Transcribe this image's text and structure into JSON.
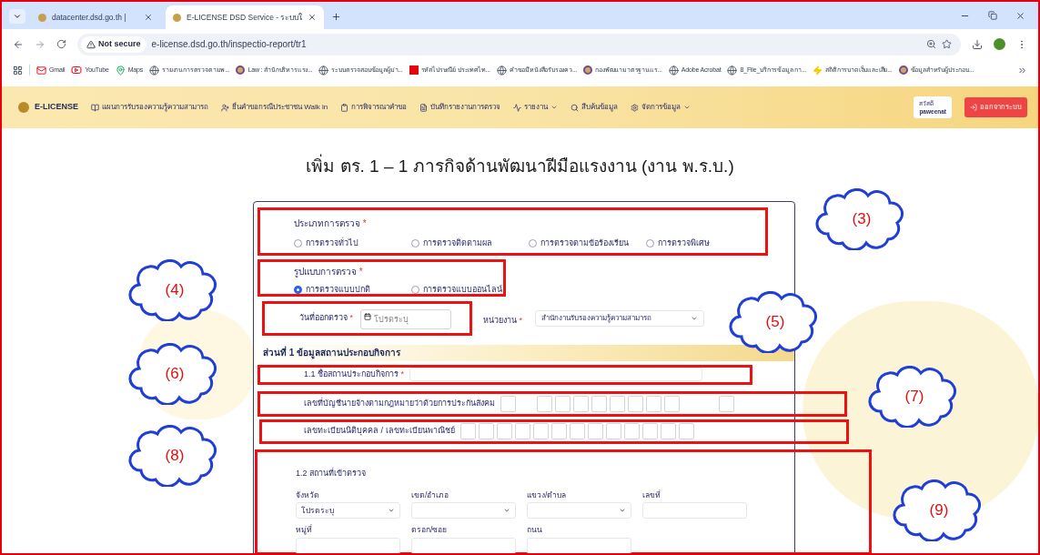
{
  "browser": {
    "tabs": [
      {
        "title": "datacenter.dsd.go.th |",
        "selected": false
      },
      {
        "title": "E-LICENSE DSD Service - ระบบใ",
        "selected": true
      }
    ],
    "address": {
      "security": "Not secure",
      "url": "e-license.dsd.go.th/inspectio-report/tr1"
    },
    "bookmarks": [
      {
        "label": "Gmail",
        "kind": "gmail"
      },
      {
        "label": "YouTube",
        "kind": "youtube"
      },
      {
        "label": "Maps",
        "kind": "maps"
      },
      {
        "label": "รายงานการตรวจตามพ...",
        "kind": "globe"
      },
      {
        "label": "Law : สำนักบริหารแรง...",
        "kind": "seal"
      },
      {
        "label": "ระบบตรวจสอบข้อมูลผู้ม่า...",
        "kind": "globe"
      },
      {
        "label": "รหัสไปรษณีย์ ประเทศไท...",
        "kind": "flag"
      },
      {
        "label": "คำขอมีหนังสือรับรองคว...",
        "kind": "globe"
      },
      {
        "label": "กองพัฒนามาตรฐานแร...",
        "kind": "seal"
      },
      {
        "label": "Adobe Acrobat",
        "kind": "globe"
      },
      {
        "label": "8_File_บริการข้อมูล กา...",
        "kind": "globe"
      },
      {
        "label": "สถิติการบาดเจ็บและเสีย...",
        "kind": "bolt"
      },
      {
        "label": "ข้อมูลสำหรับผู้ประกอบ...",
        "kind": "seal"
      }
    ]
  },
  "app": {
    "brand": "E-LICENSE",
    "nav": [
      {
        "label": "แผนการรับรองความรู้ความสามารถ",
        "dropdown": false
      },
      {
        "label": "ยื่นคำขอกรณีประชาชน Walk in",
        "dropdown": false
      },
      {
        "label": "การพิจารณาคำขอ",
        "dropdown": false
      },
      {
        "label": "บันทึกรายงานการตรวจ",
        "dropdown": false
      },
      {
        "label": "รายงาน",
        "dropdown": true
      },
      {
        "label": "สืบค้นข้อมูล",
        "dropdown": false
      },
      {
        "label": "จัดการข้อมูล",
        "dropdown": true
      }
    ],
    "user": {
      "greeting": "สวัสดี",
      "name": "paweenat"
    },
    "logout": "ออกจากระบบ"
  },
  "page_title": "เพิ่ม ตร. 1 – 1 ภารกิจด้านพัฒนาฝีมือแรงงาน (งาน พ.ร.บ.)",
  "form": {
    "inspection_type": {
      "label": "ประเภทการตรวจ",
      "required_mark": "*",
      "options": [
        {
          "label": "การตรวจทั่วไป",
          "selected": false
        },
        {
          "label": "การตรวจติดตามผล",
          "selected": false
        },
        {
          "label": "การตรวจตามข้อร้องเรียน",
          "selected": false
        },
        {
          "label": "การตรวจพิเศษ",
          "selected": false
        }
      ]
    },
    "inspection_mode": {
      "label": "รูปแบบการตรวจ",
      "required_mark": "*",
      "options": [
        {
          "label": "การตรวจแบบปกติ",
          "selected": true
        },
        {
          "label": "การตรวจแบบออนไลน์",
          "selected": false
        }
      ]
    },
    "date": {
      "label": "วันที่ออกตรวจ",
      "required_mark": "*",
      "placeholder": "โปรดระบุ"
    },
    "agency": {
      "label": "หน่วยงาน",
      "required_mark": "*",
      "value": "สำนักงานรับรองความรู้ความสามารถ"
    },
    "section_title": "ส่วนที่ 1 ข้อมูลสถานประกอบกิจการ",
    "business_name": {
      "label": "1.1 ชื่อสถานประกอบกิจการ",
      "required_mark": "*"
    },
    "social_security_no": {
      "label": "เลขที่บัญชีนายจ้างตามกฎหมายว่าด้วยการประกันสังคม"
    },
    "registration_no": {
      "label": "เลขทะเบียนนิติบุคคล / เลขทะเบียนพาณิชย์"
    },
    "location_title": "1.2 สถานที่เข้าตรวจ",
    "location_fields": [
      {
        "label": "จังหวัด",
        "kind": "select",
        "value": "โปรดระบุ"
      },
      {
        "label": "เขต/อำเภอ",
        "kind": "select"
      },
      {
        "label": "แขวง/ตำบล",
        "kind": "select"
      },
      {
        "label": "เลขที่",
        "kind": "text"
      },
      {
        "label": "หมู่ที่",
        "kind": "text"
      },
      {
        "label": "ตรอก/ซอย",
        "kind": "text"
      },
      {
        "label": "ถนน",
        "kind": "text"
      }
    ]
  },
  "callouts": [
    {
      "label": "(3)"
    },
    {
      "label": "(4)"
    },
    {
      "label": "(5)"
    },
    {
      "label": "(6)"
    },
    {
      "label": "(7)"
    },
    {
      "label": "(8)"
    },
    {
      "label": "(9)"
    }
  ]
}
